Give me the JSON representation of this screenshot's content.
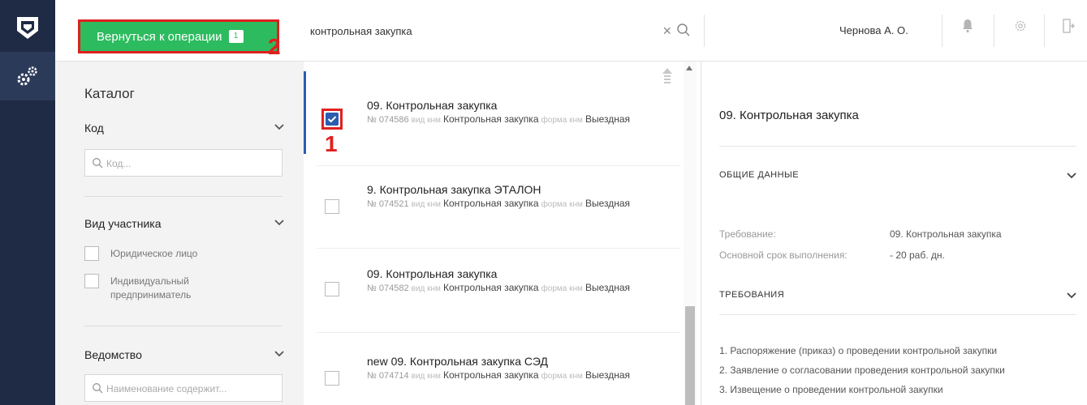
{
  "topbar": {
    "back_label": "Вернуться к операции",
    "back_badge": "1",
    "search_value": "контрольная закупка",
    "search_clear": "×",
    "user_name": "Чернова А. О."
  },
  "annotations": {
    "a1": "1",
    "a2": "2"
  },
  "catalog": {
    "title": "Каталог",
    "code": {
      "title": "Код",
      "placeholder": "Код..."
    },
    "participant": {
      "title": "Вид участника",
      "options": [
        "Юридическое лицо",
        "Индивидуальный предприниматель"
      ]
    },
    "department": {
      "title": "Ведомство",
      "placeholder": "Наименование содержит..."
    }
  },
  "list": {
    "items": [
      {
        "title": "09. Контрольная закупка",
        "num": "№ 074586",
        "type_key": "вид кнм",
        "type": "Контрольная закупка",
        "form_key": "форма кнм",
        "form": "Выездная",
        "checked": true
      },
      {
        "title": "9. Контрольная закупка ЭТАЛОН",
        "num": "№ 074521",
        "type_key": "вид кнм",
        "type": "Контрольная закупка",
        "form_key": "форма кнм",
        "form": "Выездная",
        "checked": false
      },
      {
        "title": "09. Контрольная закупка",
        "num": "№ 074582",
        "type_key": "вид кнм",
        "type": "Контрольная закупка",
        "form_key": "форма кнм",
        "form": "Выездная",
        "checked": false
      },
      {
        "title": "new 09. Контрольная закупка СЭД",
        "num": "№ 074714",
        "type_key": "вид кнм",
        "type": "Контрольная закупка",
        "form_key": "форма кнм",
        "form": "Выездная",
        "checked": false
      }
    ]
  },
  "detail": {
    "title": "09. Контрольная закупка",
    "general_section": "ОБЩИЕ ДАННЫЕ",
    "req_key": "Требование:",
    "req_val": "09. Контрольная закупка",
    "term_key": "Основной срок выполнения:",
    "term_val": "- 20 раб. дн.",
    "requirements_section": "ТРЕБОВАНИЯ",
    "requirements": [
      "1. Распоряжение (приказ) о проведении контрольной закупки",
      "2. Заявление о согласовании проведения контрольной закупки",
      "3. Извещение о проведении контрольной закупки"
    ]
  },
  "colors": {
    "accent_green": "#2dbb5f",
    "annotation_red": "#e02020",
    "rail": "#1f2a44",
    "selected_blue": "#2a5db0"
  }
}
